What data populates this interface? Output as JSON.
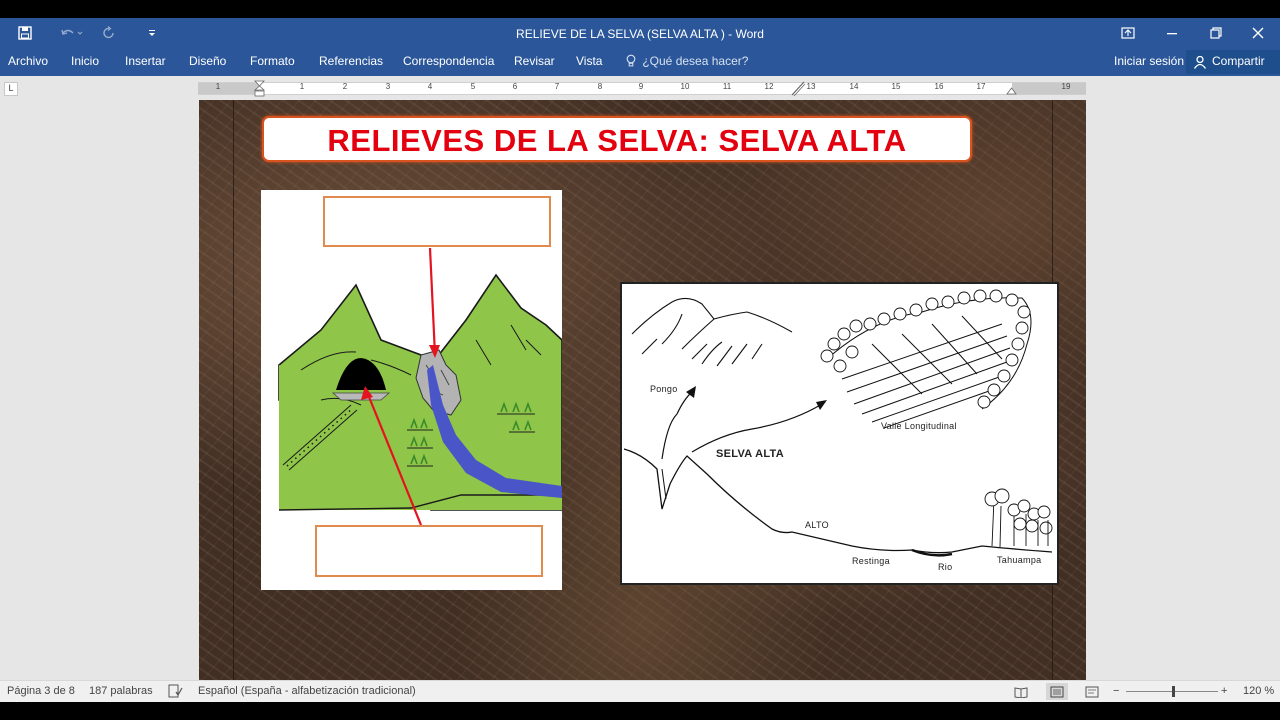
{
  "window": {
    "title": "RELIEVE DE LA SELVA  (SELVA ALTA ) - Word"
  },
  "ribbon": {
    "tabs": [
      "Archivo",
      "Inicio",
      "Insertar",
      "Diseño",
      "Formato",
      "Referencias",
      "Correspondencia",
      "Revisar",
      "Vista"
    ],
    "tell_me": "¿Qué desea hacer?",
    "sign_in": "Iniciar sesión",
    "share": "Compartir"
  },
  "ruler": {
    "numbers": [
      "1",
      "1",
      "2",
      "3",
      "4",
      "5",
      "6",
      "7",
      "8",
      "9",
      "10",
      "11",
      "12",
      "13",
      "14",
      "15",
      "16",
      "17",
      "19"
    ]
  },
  "document": {
    "heading": "RELIEVES DE LA SELVA: SELVA ALTA",
    "right_diagram_labels": {
      "pongo": "Pongo",
      "selva_alta": "SELVA ALTA",
      "valle": "Valle Longitudinal",
      "alto": "ALTO",
      "restinga": "Restinga",
      "rio": "Rio",
      "tahuampa": "Tahuampa"
    }
  },
  "status": {
    "page": "Página 3 de 8",
    "words": "187 palabras",
    "language": "Español (España - alfabetización tradicional)",
    "zoom": "120 %"
  },
  "colors": {
    "word_blue": "#2b579a",
    "heading_red": "#e3000f",
    "box_orange": "#e08a4e",
    "mountain_green": "#8fc548",
    "river_blue": "#4a55c8"
  }
}
